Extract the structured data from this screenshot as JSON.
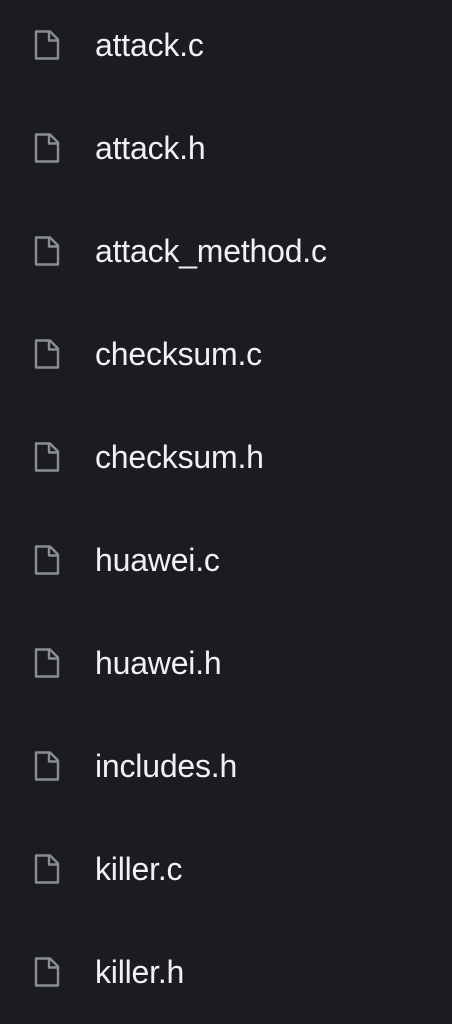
{
  "files": [
    {
      "name": "attack.c",
      "icon": "file-icon"
    },
    {
      "name": "attack.h",
      "icon": "file-icon"
    },
    {
      "name": "attack_method.c",
      "icon": "file-icon"
    },
    {
      "name": "checksum.c",
      "icon": "file-icon"
    },
    {
      "name": "checksum.h",
      "icon": "file-icon"
    },
    {
      "name": "huawei.c",
      "icon": "file-icon"
    },
    {
      "name": "huawei.h",
      "icon": "file-icon"
    },
    {
      "name": "includes.h",
      "icon": "file-icon"
    },
    {
      "name": "killer.c",
      "icon": "file-icon"
    },
    {
      "name": "killer.h",
      "icon": "file-icon"
    }
  ],
  "colors": {
    "background": "#1b1c20",
    "text": "#f0f1f3",
    "icon": "#8a8d95"
  }
}
